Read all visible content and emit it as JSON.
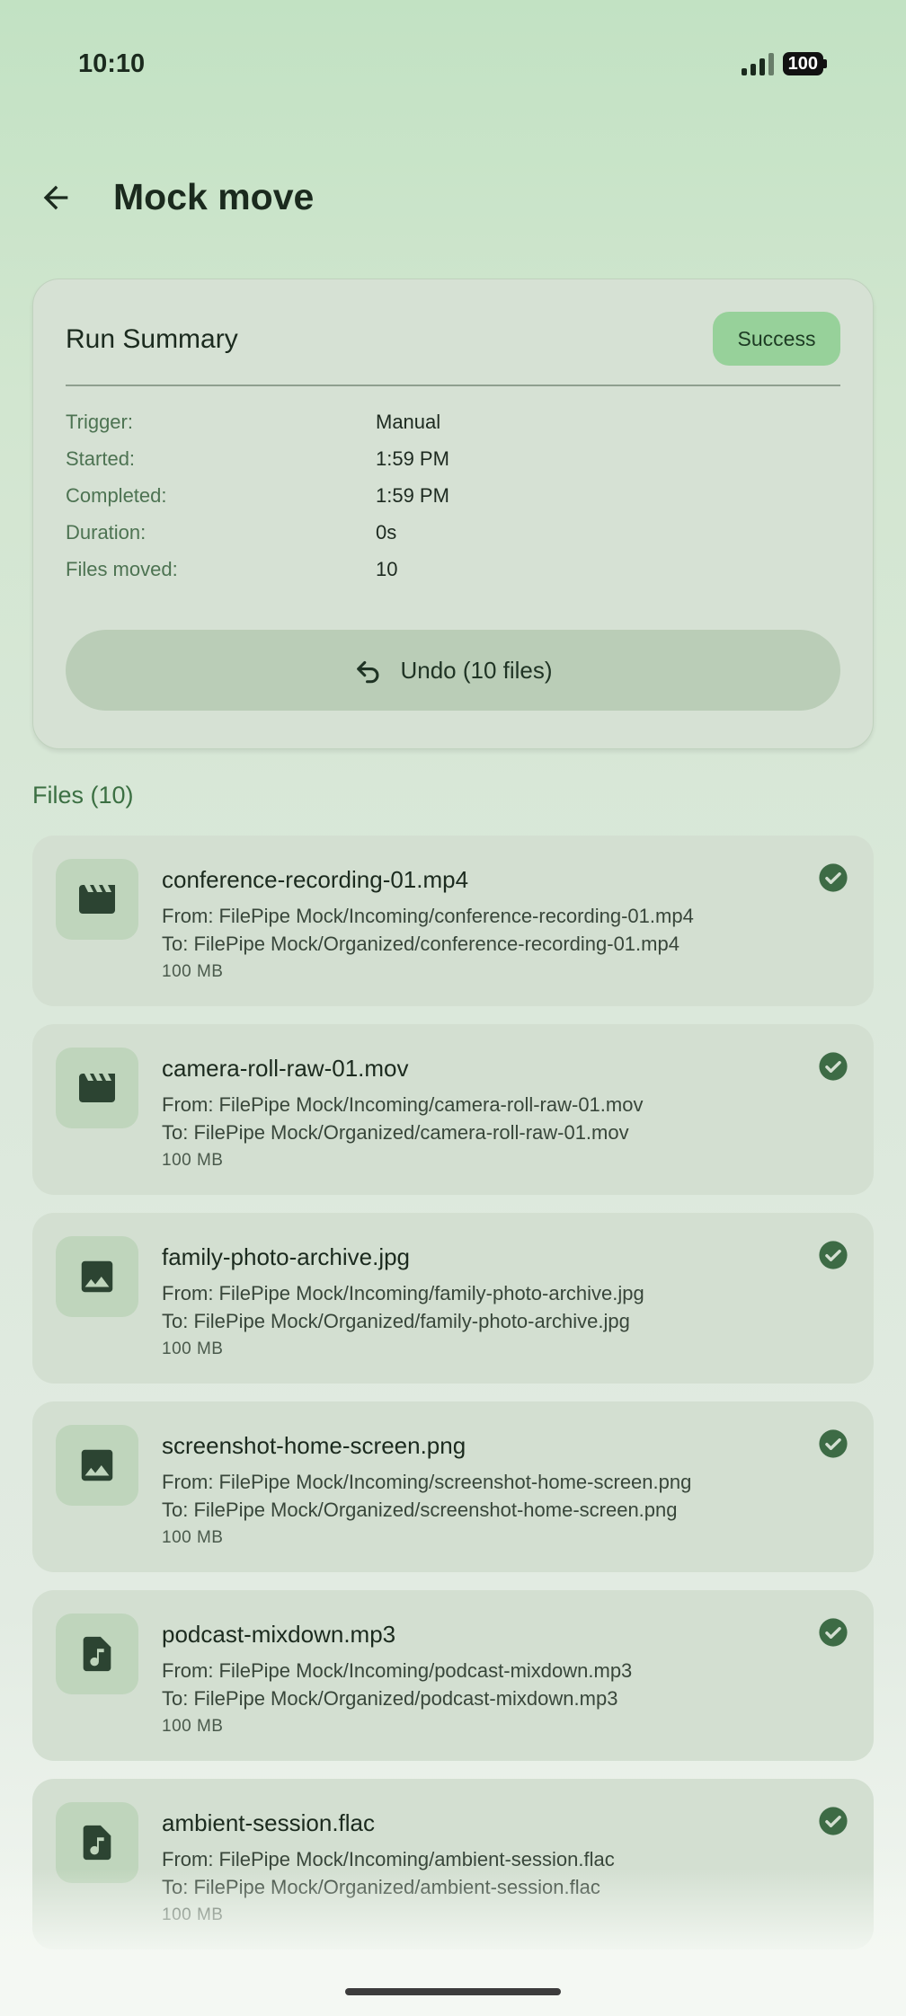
{
  "status_bar": {
    "time": "10:10",
    "battery": "100"
  },
  "header": {
    "title": "Mock move"
  },
  "summary": {
    "title": "Run Summary",
    "status_badge": "Success",
    "details": [
      {
        "label": "Trigger:",
        "value": "Manual"
      },
      {
        "label": "Started:",
        "value": "1:59 PM"
      },
      {
        "label": "Completed:",
        "value": "1:59 PM"
      },
      {
        "label": "Duration:",
        "value": "0s"
      },
      {
        "label": "Files moved:",
        "value": "10"
      }
    ],
    "undo_label": "Undo (10 files)"
  },
  "files": {
    "heading": "Files (10)",
    "items": [
      {
        "icon": "movie-icon",
        "name": "conference-recording-01.mp4",
        "from": "From: FilePipe Mock/Incoming/conference-recording-01.mp4",
        "to": "To: FilePipe Mock/Organized/conference-recording-01.mp4",
        "size": "100 MB"
      },
      {
        "icon": "movie-icon",
        "name": "camera-roll-raw-01.mov",
        "from": "From: FilePipe Mock/Incoming/camera-roll-raw-01.mov",
        "to": "To: FilePipe Mock/Organized/camera-roll-raw-01.mov",
        "size": "100 MB"
      },
      {
        "icon": "image-icon",
        "name": "family-photo-archive.jpg",
        "from": "From: FilePipe Mock/Incoming/family-photo-archive.jpg",
        "to": "To: FilePipe Mock/Organized/family-photo-archive.jpg",
        "size": "100 MB"
      },
      {
        "icon": "image-icon",
        "name": "screenshot-home-screen.png",
        "from": "From: FilePipe Mock/Incoming/screenshot-home-screen.png",
        "to": "To: FilePipe Mock/Organized/screenshot-home-screen.png",
        "size": "100 MB"
      },
      {
        "icon": "audio-file-icon",
        "name": "podcast-mixdown.mp3",
        "from": "From: FilePipe Mock/Incoming/podcast-mixdown.mp3",
        "to": "To: FilePipe Mock/Organized/podcast-mixdown.mp3",
        "size": "100 MB"
      },
      {
        "icon": "audio-file-icon",
        "name": "ambient-session.flac",
        "from": "From: FilePipe Mock/Incoming/ambient-session.flac",
        "to": "To: FilePipe Mock/Organized/ambient-session.flac",
        "size": "100 MB"
      }
    ]
  },
  "colors": {
    "accent_green": "#3b6f42",
    "success_badge": "#97d19a",
    "check_green": "#3d6b45"
  }
}
